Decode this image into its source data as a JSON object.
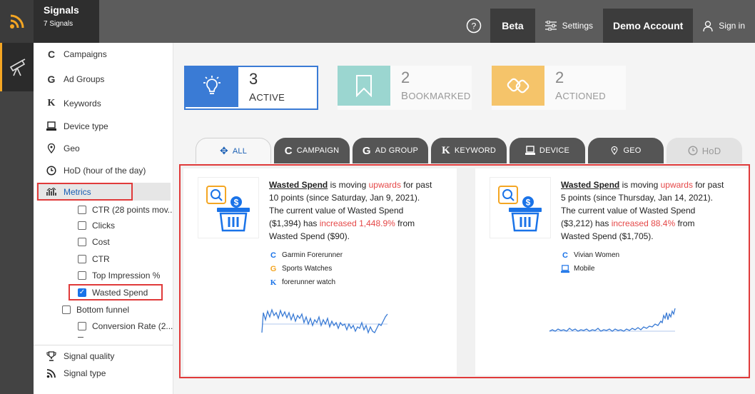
{
  "header": {
    "title": "Signals",
    "subtitle": "7 Signals",
    "help_icon": "help-circle-icon",
    "beta_label": "Beta",
    "settings_label": "Settings",
    "account_label": "Demo Account",
    "signin_label": "Sign in"
  },
  "sidebar": {
    "items": [
      {
        "icon": "C",
        "label": "Campaigns"
      },
      {
        "icon": "G",
        "label": "Ad Groups"
      },
      {
        "icon": "K",
        "label": "Keywords"
      },
      {
        "icon": "device-icon",
        "label": "Device type"
      },
      {
        "icon": "pin-icon",
        "label": "Geo"
      },
      {
        "icon": "clock-icon",
        "label": "HoD (hour of the day)"
      },
      {
        "icon": "chart-icon",
        "label": "Metrics"
      }
    ],
    "metrics_children": [
      {
        "label": "CTR (28 points mov...",
        "checked": false
      },
      {
        "label": "Clicks",
        "checked": false
      },
      {
        "label": "Cost",
        "checked": false
      },
      {
        "label": "CTR",
        "checked": false
      },
      {
        "label": "Top Impression %",
        "checked": false
      },
      {
        "label": "Wasted Spend",
        "checked": true
      }
    ],
    "bottom_funnel": {
      "label": "Bottom funnel",
      "checked": false
    },
    "bottom_children": [
      {
        "label": "Conversion Rate (2...",
        "checked": false
      }
    ],
    "footer_items": [
      {
        "icon": "trophy-icon",
        "label": "Signal quality"
      },
      {
        "icon": "rss-icon",
        "label": "Signal type"
      }
    ]
  },
  "stats": [
    {
      "count": "3",
      "label": "Active",
      "color": "#3a7bd5",
      "icon": "lightbulb-icon"
    },
    {
      "count": "2",
      "label": "Bookmarked",
      "color": "#9bd6d0",
      "icon": "bookmark-icon"
    },
    {
      "count": "2",
      "label": "Actioned",
      "color": "#f5c46a",
      "icon": "link-icon"
    }
  ],
  "tabs": [
    {
      "label": "All",
      "icon": "move-icon"
    },
    {
      "label": "Campaign",
      "icon": "C"
    },
    {
      "label": "Ad Group",
      "icon": "G"
    },
    {
      "label": "Keyword",
      "icon": "K"
    },
    {
      "label": "Device",
      "icon": "device-icon"
    },
    {
      "label": "Geo",
      "icon": "pin-icon"
    },
    {
      "label": "HoD",
      "icon": "clock-icon"
    }
  ],
  "cards": [
    {
      "metric": "Wasted Spend",
      "t1": " is moving ",
      "direction": "upwards",
      "t2": " for past 10 points (since Saturday, Jan 9, 2021). The current value of Wasted Spend ($1,394) has ",
      "change": "increased 1,448.9%",
      "t3": " from Wasted Spend ($90).",
      "tags": [
        {
          "icon": "C",
          "label": "Garmin Forerunner"
        },
        {
          "icon": "G",
          "label": "Sports Watches"
        },
        {
          "icon": "K",
          "label": "forerunner watch"
        }
      ]
    },
    {
      "metric": "Wasted Spend",
      "t1": " is moving ",
      "direction": "upwards",
      "t2": " for past 5 points (since Thursday, Jan 14, 2021). The current value of Wasted Spend ($3,212) has ",
      "change": "increased 88.4%",
      "t3": " from Wasted Spend ($1,705).",
      "tags": [
        {
          "icon": "C",
          "label": "Vivian Women"
        },
        {
          "icon": "device-icon",
          "label": "Mobile"
        }
      ]
    }
  ]
}
